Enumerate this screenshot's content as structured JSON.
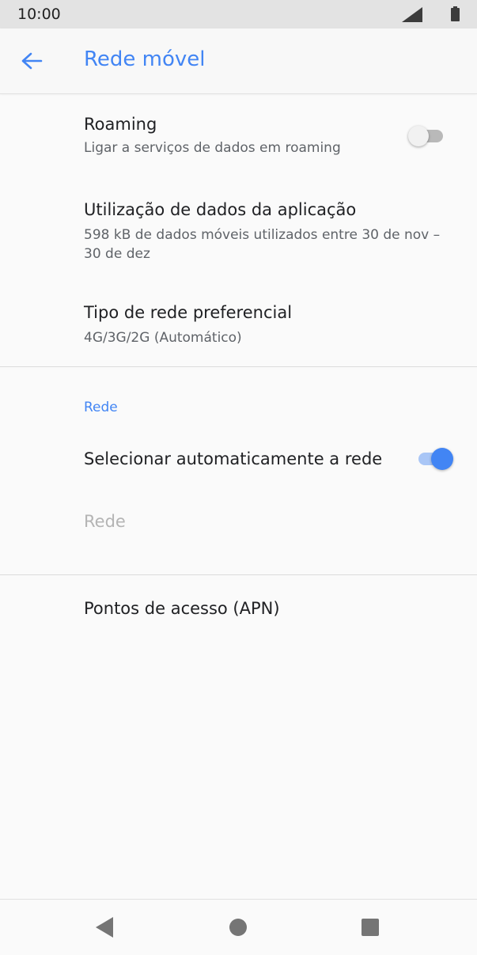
{
  "status_bar": {
    "time": "10:00",
    "icons": [
      "signal-icon",
      "battery-icon"
    ]
  },
  "app_bar": {
    "title": "Rede móvel",
    "back_icon": "arrow-back-icon",
    "accent_color": "#4285f4"
  },
  "settings": {
    "roaming": {
      "title": "Roaming",
      "summary": "Ligar a serviços de dados em roaming",
      "enabled": false
    },
    "app_data_usage": {
      "title": "Utilização de dados da aplicação",
      "summary": "598 kB de dados móveis utilizados entre 30 de nov – 30 de dez"
    },
    "preferred_network_type": {
      "title": "Tipo de rede preferencial",
      "summary": "4G/3G/2G (Automático)"
    },
    "network_section": {
      "header": "Rede",
      "auto_select": {
        "title": "Selecionar automaticamente a rede",
        "enabled": true
      },
      "network": {
        "title": "Rede",
        "disabled": true
      }
    },
    "apn": {
      "title": "Pontos de acesso (APN)"
    }
  },
  "nav_bar": {
    "icons": [
      "nav-back-icon",
      "nav-home-icon",
      "nav-overview-icon"
    ]
  }
}
